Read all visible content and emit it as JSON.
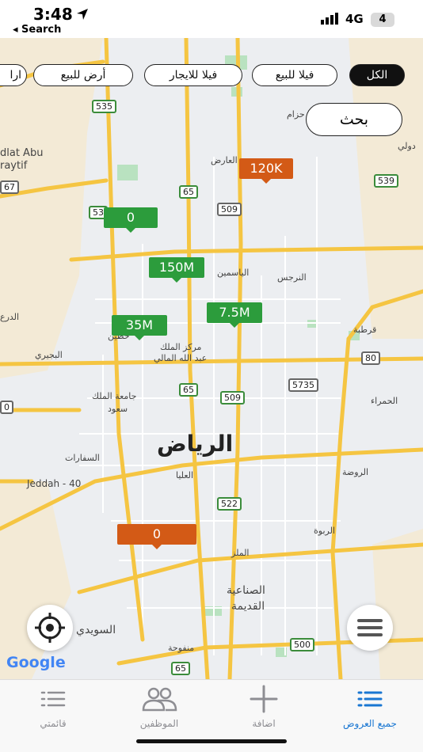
{
  "status_bar": {
    "time": "3:48",
    "back_label": "◂ Search",
    "network": "4G",
    "battery": "4"
  },
  "filters": {
    "all": "الكل",
    "villa_sale": "فيلا للبيع",
    "villa_rent": "فيلا للايجار",
    "land_sale": "أرض للبيع",
    "partial": "ارا"
  },
  "search_button": "بحث",
  "map": {
    "city": "الرياض",
    "labels": {
      "yasmin": "الياسمين",
      "narjis": "النرجس",
      "arid": "العارض",
      "kafd_1": "مركز الملك",
      "kafd_2": "عبد الله المالي",
      "qurtuba": "قرطبة",
      "bujairi": "البجيري",
      "hamra": "الحمراء",
      "ksu_1": "جامعة الملك",
      "ksu_2": "سعود",
      "safarat": "السفارات",
      "olaya": "العليا",
      "rawdah": "الروضة",
      "rabwah": "الربوة",
      "malaz": "الملز",
      "sinaiya_1": "الصناعية",
      "sinaiya_2": "القديمة",
      "suwaidi": "السويدي",
      "manfuhah": "منفوحة",
      "hazm": "حزام",
      "duwali": "دولي",
      "diriyah": "الدرع",
      "hittin": "حطين",
      "dlat_abu": "dlat Abu",
      "raytif": "raytif",
      "jeddah": "Jeddah - 40"
    },
    "shields": {
      "s535": "535",
      "s65a": "65",
      "s509a": "509",
      "s53": "53",
      "s539": "539",
      "s67": "67",
      "s80": "80",
      "s5735": "5735",
      "s65b": "65",
      "s509b": "509",
      "s0": "0",
      "s522": "522",
      "s500": "500",
      "s65c": "65"
    },
    "markers": {
      "m120k": "120K",
      "m0a": "0",
      "m150m": "150M",
      "m75m": "7.5M",
      "m35m": "35M",
      "m0b": "0"
    },
    "google": "Google"
  },
  "tabs": {
    "all_offers": "جميع العروض",
    "add": "اضافة",
    "employees": "الموظفين",
    "my_list": "قائمتي"
  },
  "colors": {
    "accent": "#1976d2",
    "marker_green": "#2c9c3c",
    "marker_orange": "#d35a16"
  }
}
